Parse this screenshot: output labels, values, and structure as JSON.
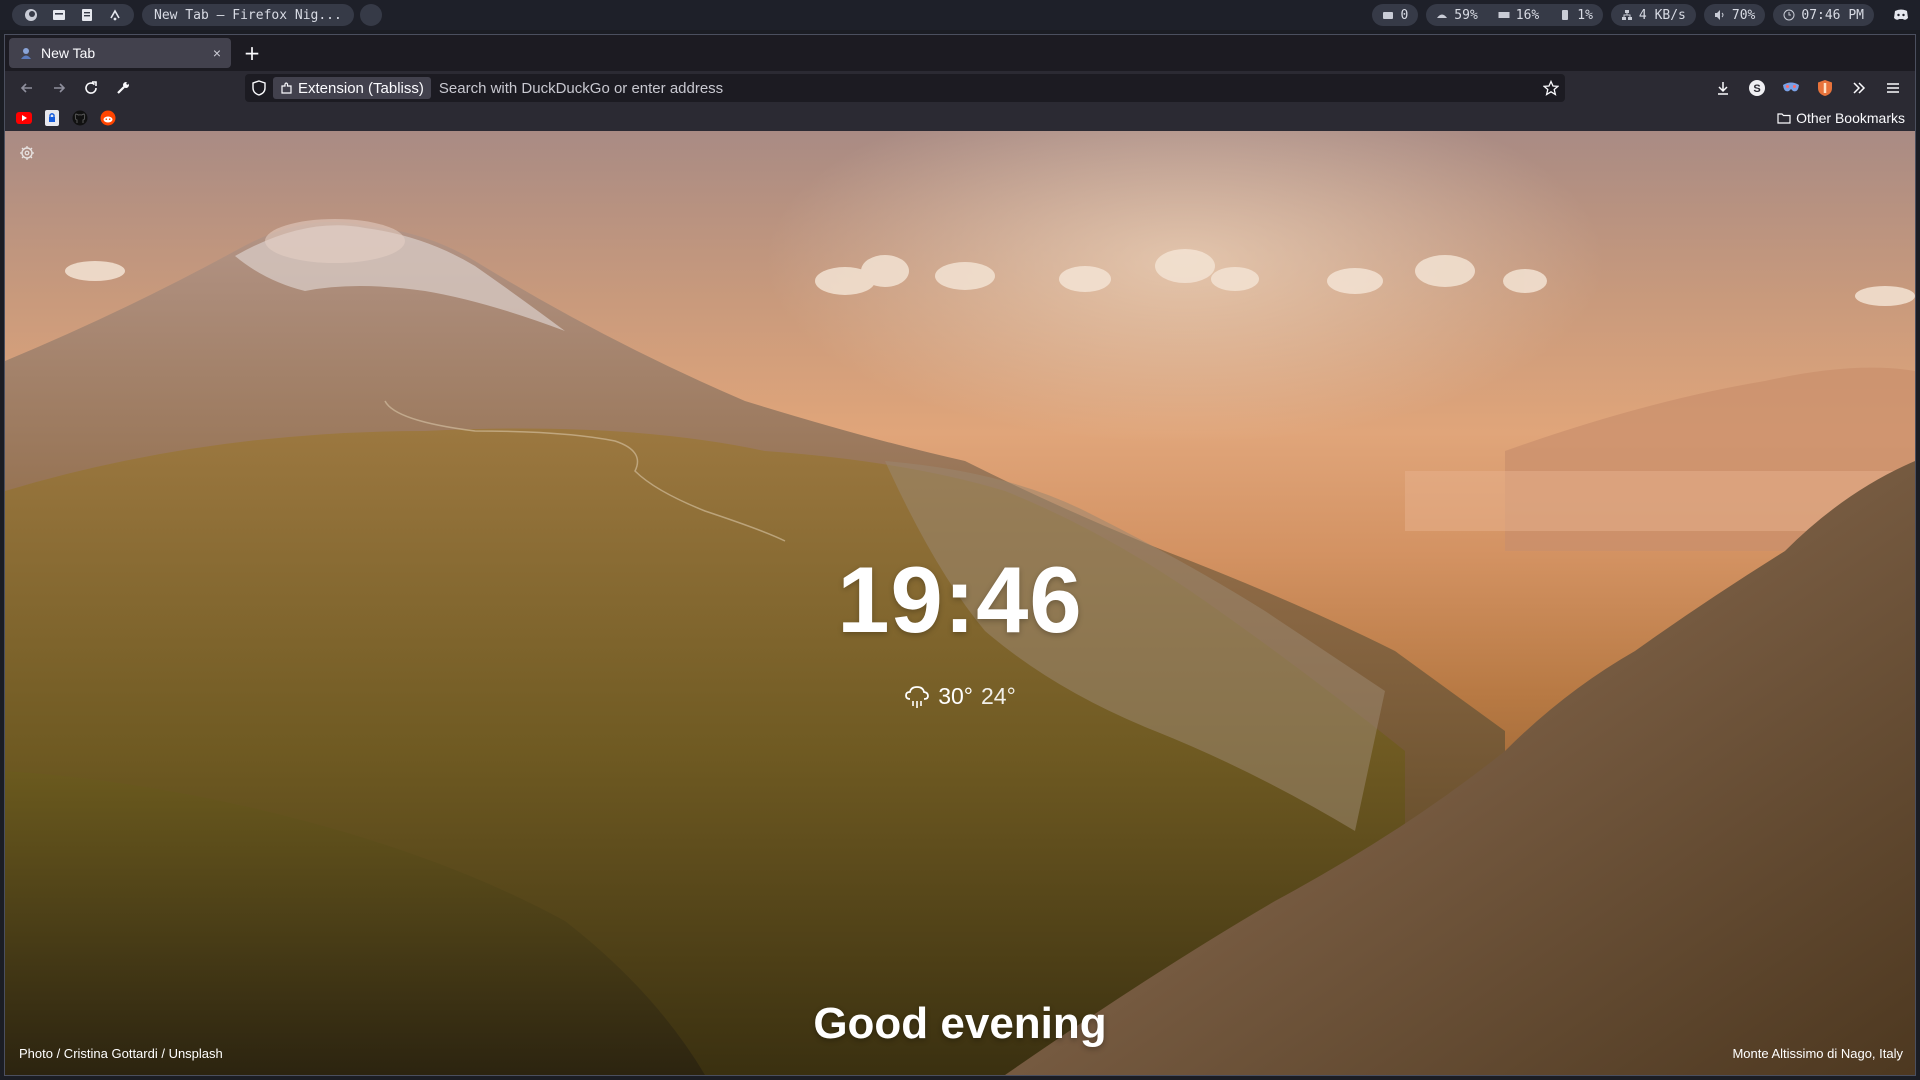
{
  "sysbar": {
    "workspaces": [
      "firefox-icon",
      "terminal-icon",
      "files-icon",
      "apps-icon"
    ],
    "window_title": "New Tab — Firefox Nig...",
    "notifications": "0",
    "cpu": "59%",
    "memory": "16%",
    "disk": "1%",
    "network": "4 KB/s",
    "volume": "70%",
    "clock": "07:46 PM"
  },
  "browser": {
    "tab": {
      "label": "New Tab",
      "close": "×"
    },
    "new_tab": "+",
    "urlbar": {
      "extension_label": "Extension (Tabliss)",
      "placeholder": "Search with DuckDuckGo or enter address"
    },
    "bookmarks": {
      "items": [
        "youtube-icon",
        "bitwarden-icon",
        "github-icon",
        "reddit-icon"
      ],
      "other": "Other Bookmarks"
    }
  },
  "newtab": {
    "time": "19:46",
    "weather": {
      "icon": "rain-cloud-icon",
      "high": "30°",
      "low": "24°"
    },
    "greeting": "Good evening",
    "credit": "Photo / Cristina Gottardi / Unsplash",
    "location": "Monte Altissimo di Nago, Italy"
  },
  "colors": {
    "sysbar_bg": "#1e2029",
    "pill_bg": "#363a47",
    "toolbar_bg": "#2b2a33",
    "tab_active": "#42414d",
    "sky_peach": "#e0a57a",
    "youtube_red": "#ff0000",
    "reddit_orange": "#ff4500"
  }
}
